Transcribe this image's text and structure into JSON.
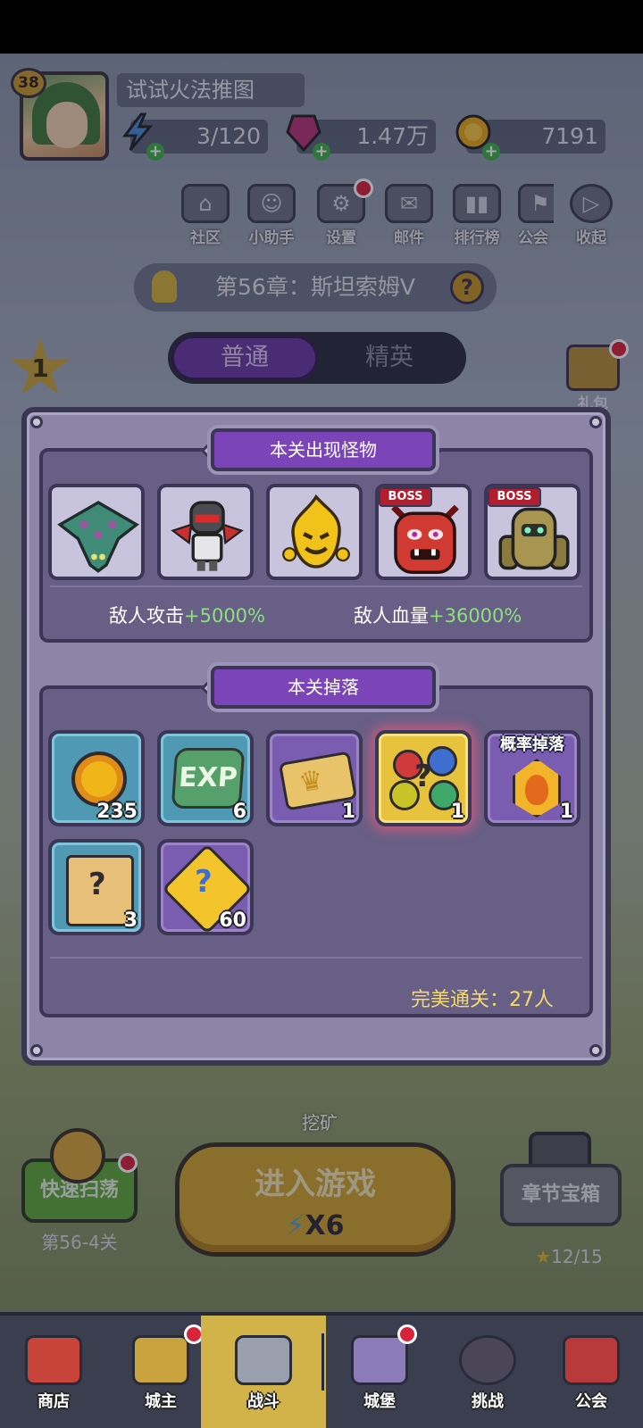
{
  "player": {
    "level": "38",
    "name": "试试火法推图"
  },
  "resources": {
    "stamina": "3/120",
    "gems": "1.47万",
    "gold": "7191"
  },
  "top_icons": [
    {
      "label": "社区",
      "icon": "community-icon"
    },
    {
      "label": "小助手",
      "icon": "robot-icon"
    },
    {
      "label": "设置",
      "icon": "gear-icon"
    },
    {
      "label": "邮件",
      "icon": "mail-icon"
    },
    {
      "label": "排行榜",
      "icon": "ranking-icon"
    },
    {
      "label": "公会",
      "icon": "guild-icon"
    },
    {
      "label": "收起",
      "icon": "collapse-icon"
    }
  ],
  "chapter": {
    "title": "第56章：斯坦索姆Ⅴ"
  },
  "mode_tabs": [
    {
      "label": "普通",
      "active": true
    },
    {
      "label": "精英",
      "active": false
    }
  ],
  "side": {
    "first_clear_star": "1",
    "gift_label": "礼包"
  },
  "modal": {
    "monsters_title": "本关出现怪物",
    "monsters": [
      {
        "name": "manta-monster",
        "boss": false
      },
      {
        "name": "armored-skeleton-monster",
        "boss": false
      },
      {
        "name": "flame-spirit-monster",
        "boss": false
      },
      {
        "name": "red-demon-boss",
        "boss": true
      },
      {
        "name": "stone-golem-boss",
        "boss": true
      }
    ],
    "boss_label": "BOSS",
    "attack_label": "敌人攻击",
    "attack_value": "+5000%",
    "hp_label": "敌人血量",
    "hp_value": "+36000%",
    "drops_title": "本关掉落",
    "drops": [
      {
        "item": "gold-coin",
        "count": "235",
        "frame": "blue"
      },
      {
        "item": "exp-crystal",
        "count": "6",
        "frame": "blue"
      },
      {
        "item": "crown-ticket",
        "count": "1",
        "frame": "purple"
      },
      {
        "item": "random-gem-pile",
        "count": "1",
        "frame": "gold"
      },
      {
        "item": "flame-crest",
        "count": "1",
        "frame": "purple"
      },
      {
        "item": "mystery-scroll",
        "count": "3",
        "frame": "blue"
      },
      {
        "item": "mystery-puzzle",
        "count": "60",
        "frame": "purple"
      }
    ],
    "prob_drop_label": "概率掉落",
    "perfect_clear": "完美通关：27人"
  },
  "bottom": {
    "mine_label": "挖矿",
    "sweep_label": "快速扫荡",
    "sweep_stage": "第56-4关",
    "enter_label": "进入游戏",
    "enter_cost": "X6",
    "chest_label": "章节宝箱",
    "chest_progress": "12/15"
  },
  "nav": [
    {
      "label": "商店",
      "active": false
    },
    {
      "label": "城主",
      "active": false
    },
    {
      "label": "战斗",
      "active": true
    },
    {
      "label": "城堡",
      "active": false
    },
    {
      "label": "挑战",
      "active": false
    },
    {
      "label": "公会",
      "active": false
    }
  ],
  "colors": {
    "accent_purple": "#7b45b9",
    "bonus_green": "#8ee07c",
    "perfect_yellow": "#f3d96a",
    "nav_active": "#d2b34a"
  }
}
